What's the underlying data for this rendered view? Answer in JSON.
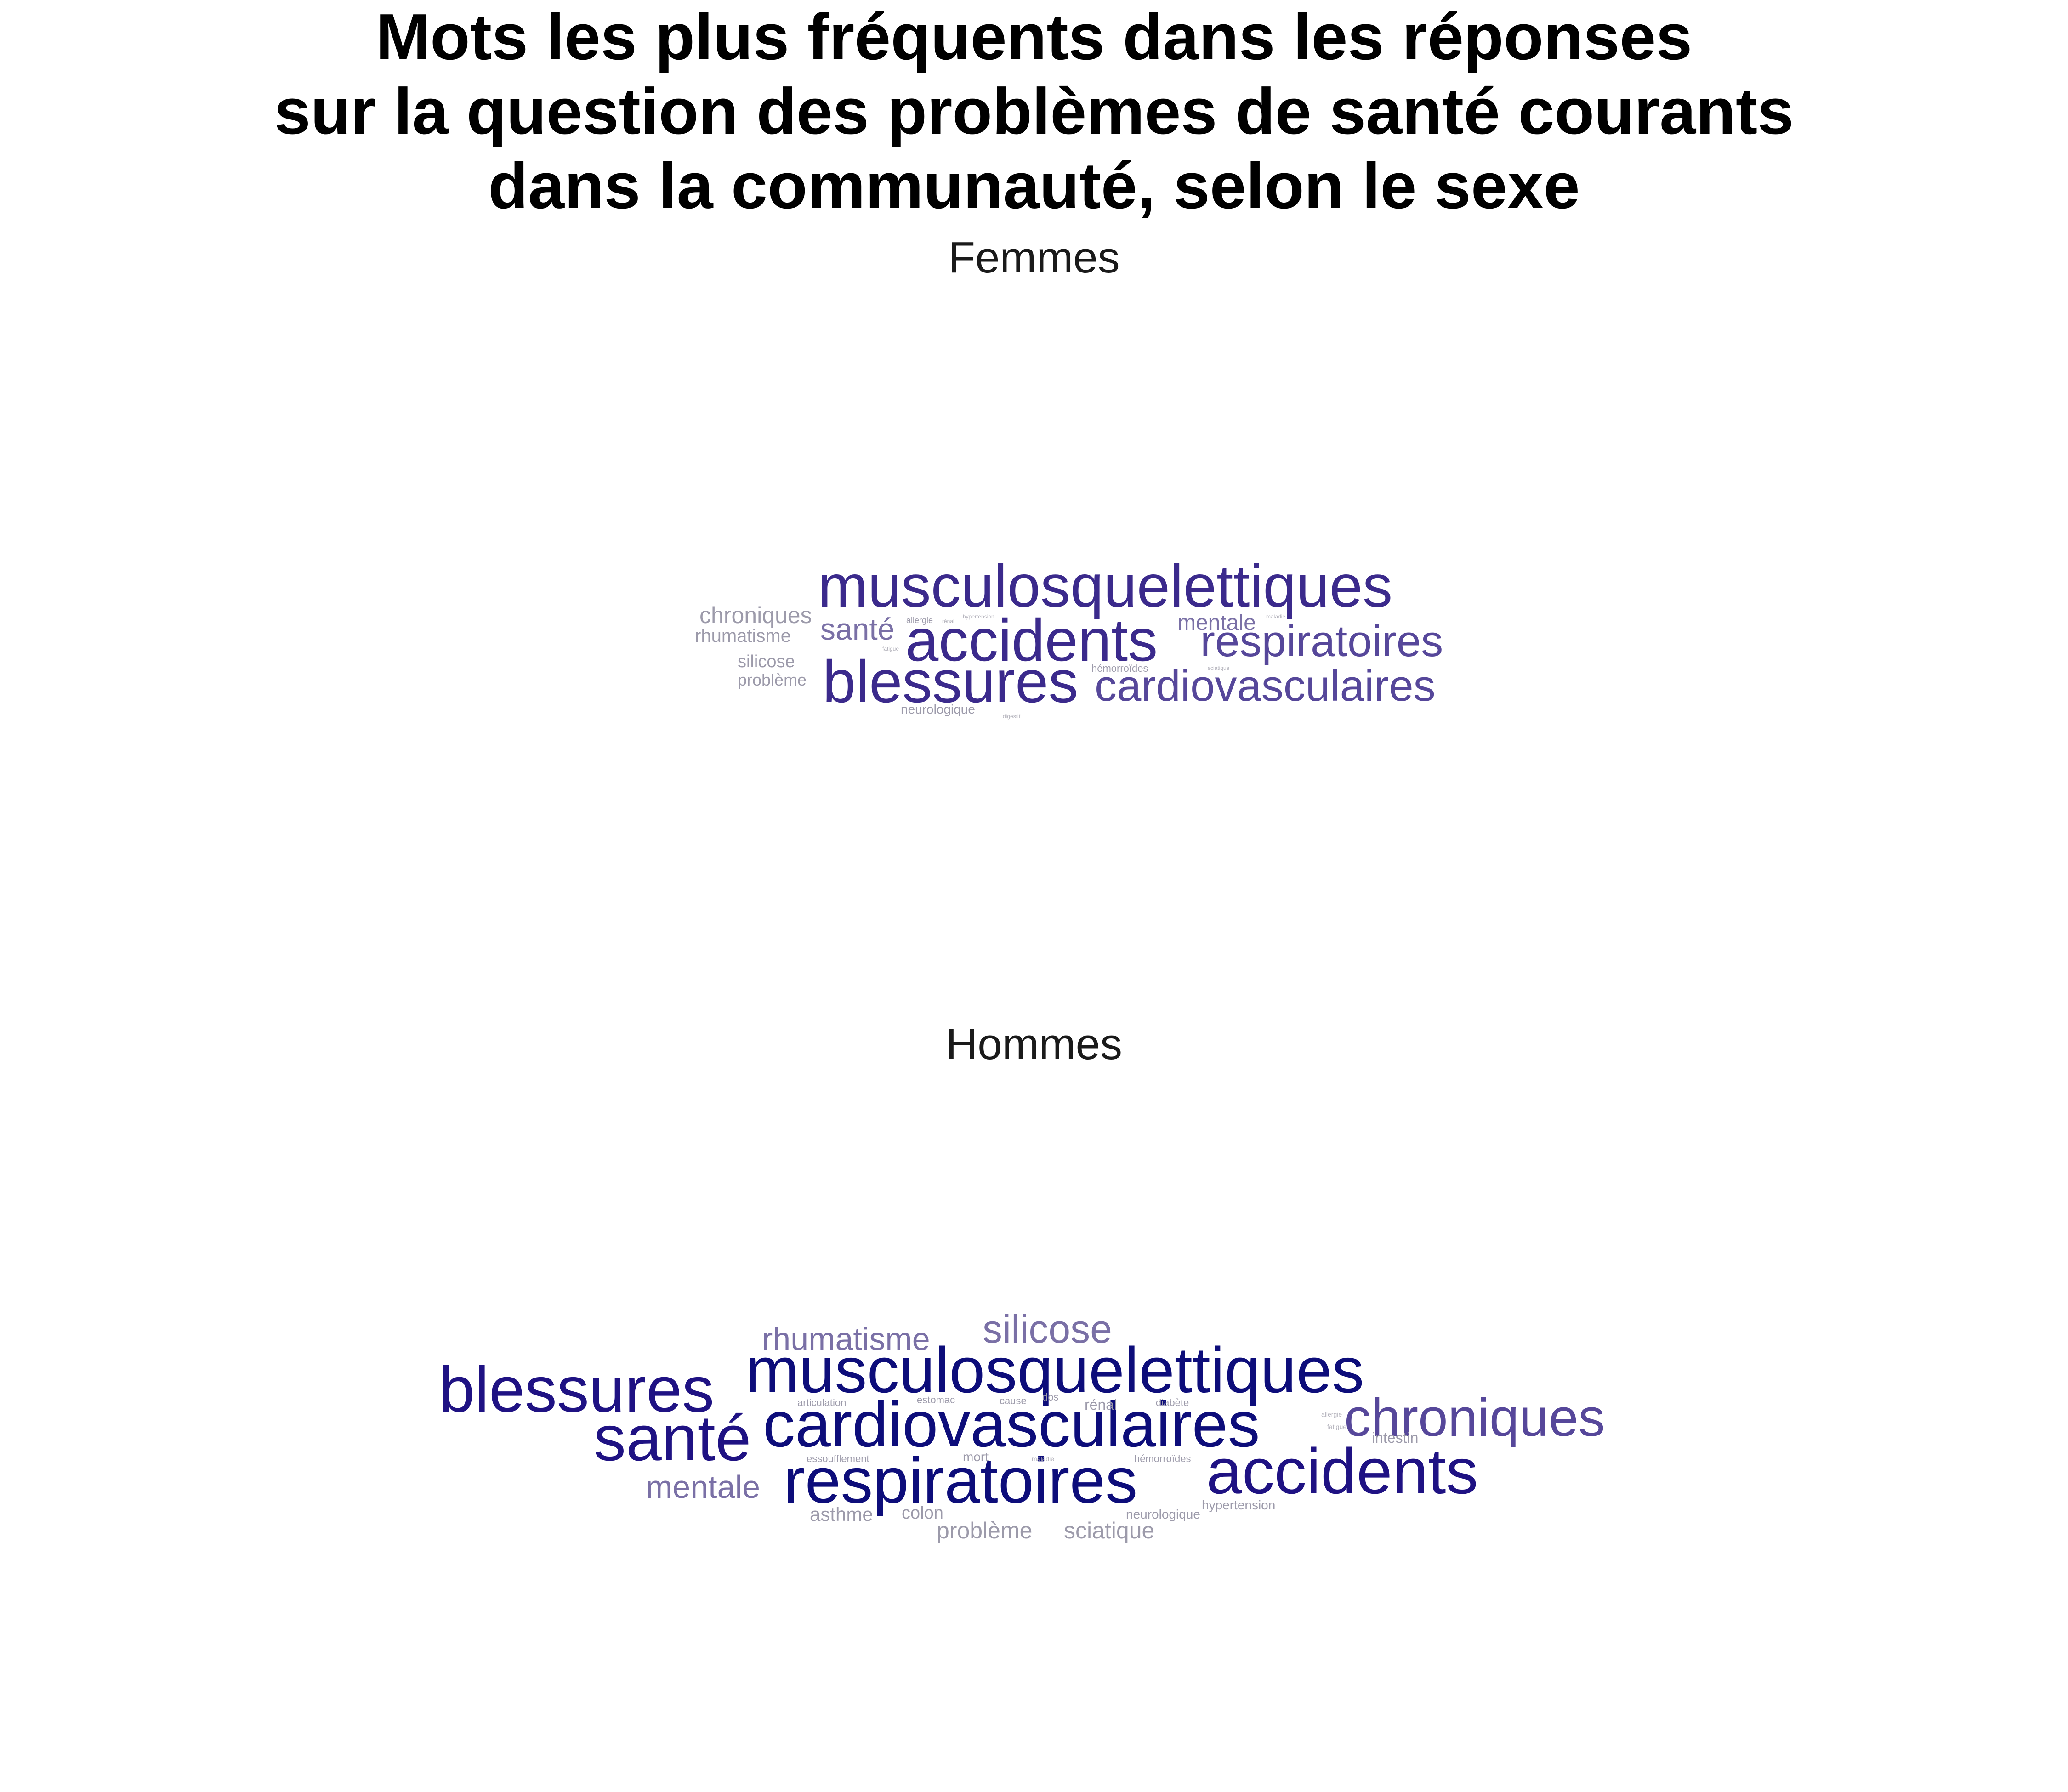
{
  "title_lines": [
    "Mots les plus fréquents dans les réponses",
    "sur la question des problèmes de santé courants",
    "dans la communauté, selon le sexe"
  ],
  "colors": {
    "darkest": "#0d0d7a",
    "dark": "#1f1283",
    "mid": "#3b2a8c",
    "medium": "#56479a",
    "light": "#7a70a6",
    "grey": "#9c9aaa",
    "pale": "#b5b4bd"
  },
  "chart_data": [
    {
      "type": "wordcloud",
      "panel": "Femmes",
      "words": [
        {
          "word": "musculosquelettiques",
          "size": 10,
          "tone": "mid"
        },
        {
          "word": "accidents",
          "size": 10,
          "tone": "mid"
        },
        {
          "word": "blessures",
          "size": 10,
          "tone": "mid"
        },
        {
          "word": "respiratoires",
          "size": 8,
          "tone": "medium"
        },
        {
          "word": "cardiovasculaires",
          "size": 8,
          "tone": "medium"
        },
        {
          "word": "santé",
          "size": 5,
          "tone": "light"
        },
        {
          "word": "mentale",
          "size": 4,
          "tone": "light"
        },
        {
          "word": "chroniques",
          "size": 4,
          "tone": "grey"
        },
        {
          "word": "rhumatisme",
          "size": 3,
          "tone": "grey"
        },
        {
          "word": "silicose",
          "size": 3,
          "tone": "grey"
        },
        {
          "word": "problème",
          "size": 3,
          "tone": "grey"
        },
        {
          "word": "neurologique",
          "size": 2,
          "tone": "grey"
        },
        {
          "word": "hémorroïdes",
          "size": 2,
          "tone": "grey"
        },
        {
          "word": "allergie",
          "size": 2,
          "tone": "grey"
        },
        {
          "word": "hypertension",
          "size": 1,
          "tone": "pale"
        },
        {
          "word": "rénal",
          "size": 1,
          "tone": "pale"
        },
        {
          "word": "maladie",
          "size": 1,
          "tone": "pale"
        },
        {
          "word": "digestif",
          "size": 1,
          "tone": "pale"
        },
        {
          "word": "sciatique",
          "size": 1,
          "tone": "pale"
        },
        {
          "word": "fatigue",
          "size": 1,
          "tone": "pale"
        }
      ]
    },
    {
      "type": "wordcloud",
      "panel": "Hommes",
      "words": [
        {
          "word": "musculosquelettiques",
          "size": 10,
          "tone": "darkest"
        },
        {
          "word": "cardiovasculaires",
          "size": 10,
          "tone": "darkest"
        },
        {
          "word": "respiratoires",
          "size": 10,
          "tone": "darkest"
        },
        {
          "word": "blessures",
          "size": 10,
          "tone": "dark"
        },
        {
          "word": "accidents",
          "size": 10,
          "tone": "dark"
        },
        {
          "word": "santé",
          "size": 10,
          "tone": "dark"
        },
        {
          "word": "chroniques",
          "size": 8,
          "tone": "medium"
        },
        {
          "word": "silicose",
          "size": 6,
          "tone": "light"
        },
        {
          "word": "rhumatisme",
          "size": 5,
          "tone": "light"
        },
        {
          "word": "mentale",
          "size": 5,
          "tone": "light"
        },
        {
          "word": "problème",
          "size": 4,
          "tone": "grey"
        },
        {
          "word": "sciatique",
          "size": 4,
          "tone": "grey"
        },
        {
          "word": "asthme",
          "size": 3,
          "tone": "grey"
        },
        {
          "word": "colon",
          "size": 3,
          "tone": "grey"
        },
        {
          "word": "intestin",
          "size": 3,
          "tone": "grey"
        },
        {
          "word": "rénal",
          "size": 3,
          "tone": "grey"
        },
        {
          "word": "mort",
          "size": 2,
          "tone": "grey"
        },
        {
          "word": "neurologique",
          "size": 2,
          "tone": "grey"
        },
        {
          "word": "hypertension",
          "size": 2,
          "tone": "grey"
        },
        {
          "word": "essoufflement",
          "size": 2,
          "tone": "grey"
        },
        {
          "word": "articulation",
          "size": 2,
          "tone": "grey"
        },
        {
          "word": "estomac",
          "size": 2,
          "tone": "grey"
        },
        {
          "word": "cause",
          "size": 2,
          "tone": "grey"
        },
        {
          "word": "dos",
          "size": 2,
          "tone": "grey"
        },
        {
          "word": "diabète",
          "size": 2,
          "tone": "grey"
        },
        {
          "word": "hémorroïdes",
          "size": 2,
          "tone": "grey"
        },
        {
          "word": "allergie",
          "size": 1,
          "tone": "pale"
        },
        {
          "word": "fatigue",
          "size": 1,
          "tone": "pale"
        },
        {
          "word": "maladie",
          "size": 1,
          "tone": "pale"
        }
      ]
    }
  ]
}
